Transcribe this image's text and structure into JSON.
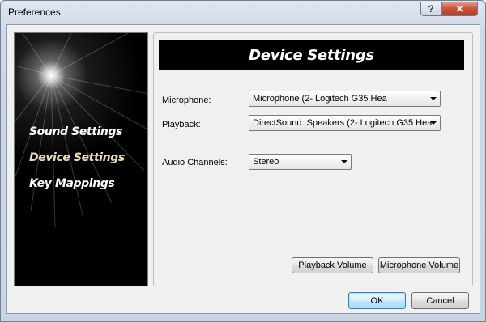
{
  "window": {
    "title": "Preferences",
    "help_glyph": "?",
    "close_glyph": "✕"
  },
  "sidebar": {
    "items": [
      {
        "label": "Sound Settings",
        "active": false
      },
      {
        "label": "Device Settings",
        "active": true
      },
      {
        "label": "Key Mappings",
        "active": false
      }
    ]
  },
  "main": {
    "title": "Device Settings",
    "fields": {
      "microphone": {
        "label": "Microphone:",
        "value": "Microphone (2- Logitech G35 Hea"
      },
      "playback": {
        "label": "Playback:",
        "value": "DirectSound: Speakers (2- Logitech G35 Hea"
      },
      "audio_channels": {
        "label": "Audio Channels:",
        "value": "Stereo"
      }
    },
    "buttons": {
      "playback_volume": "Playback Volume",
      "microphone_volume": "Microphone Volume"
    }
  },
  "footer": {
    "ok": "OK",
    "cancel": "Cancel"
  },
  "colors": {
    "accent_active_item": "#e8e0b2",
    "header_bg": "#000000",
    "close_button": "#c8533a"
  },
  "icons": [
    "help-icon",
    "close-icon",
    "chevron-down-icon"
  ]
}
